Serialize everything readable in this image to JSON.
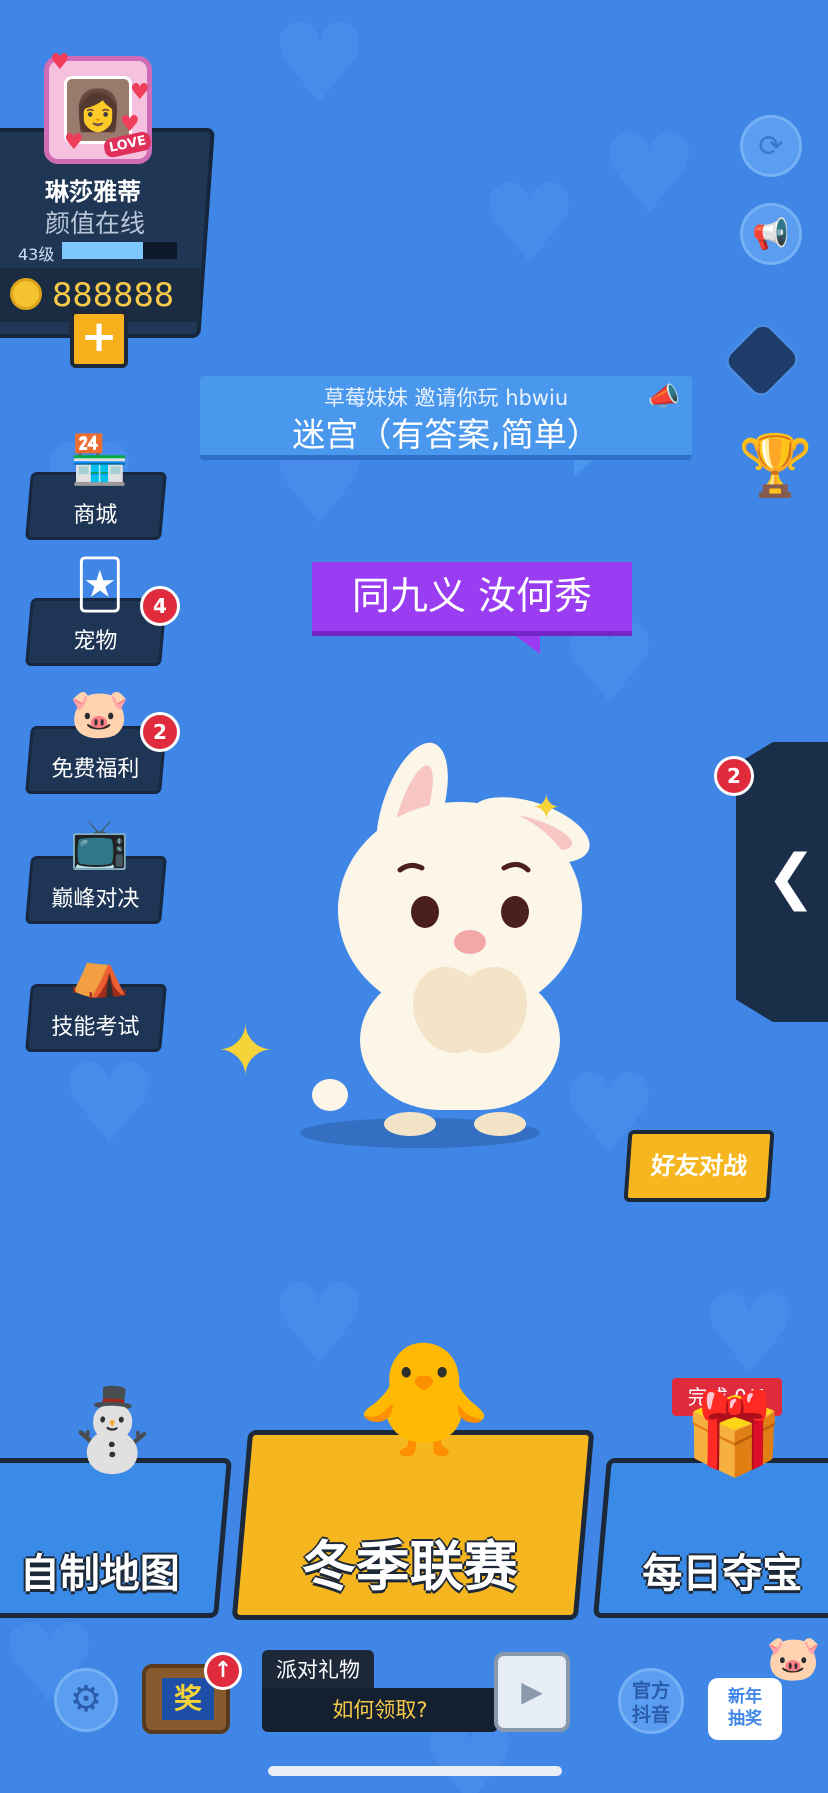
{
  "profile": {
    "name": "琳莎雅蒂",
    "subtitle": "颜值在线",
    "level": "43级",
    "level_progress": 0.7,
    "coins": "888888",
    "frame_tag": "LOVE"
  },
  "announcement": {
    "inviter": "草莓妹妹 邀请你玩 hbwiu",
    "map_name": "迷宫（有答案,简单）"
  },
  "speech": "同九义 汝何秀",
  "left_menu": [
    {
      "label": "商城",
      "icon": "shop-icon"
    },
    {
      "label": "宠物",
      "icon": "pet-cards-icon",
      "badge": "4"
    },
    {
      "label": "免费福利",
      "icon": "piggy-bank-icon",
      "badge": "2"
    },
    {
      "label": "巅峰对决",
      "icon": "tv-icon"
    },
    {
      "label": "技能考试",
      "icon": "tent-icon"
    }
  ],
  "right_drawer": {
    "badge": "2",
    "icon": "chevron-left-icon"
  },
  "friend_battle": "好友对战",
  "bottom": {
    "custom_map": "自制地图",
    "winter_league": "冬季联赛",
    "daily_treasure": "每日夺宝",
    "task_tag": "完成 0/4"
  },
  "footer": {
    "award_tv": "奖",
    "gift_title": "派对礼物",
    "gift_action": "如何领取?",
    "douyin": "官方抖音",
    "douyin_line1": "官方",
    "douyin_line2": "抖音",
    "newyear_line1": "新年",
    "newyear_line2": "抽奖"
  },
  "colors": {
    "background": "#3f86e6",
    "panel": "#1e3555",
    "accent_yellow": "#f5b61f",
    "badge_red": "#e02b3d",
    "purple": "#9a3cf1"
  }
}
